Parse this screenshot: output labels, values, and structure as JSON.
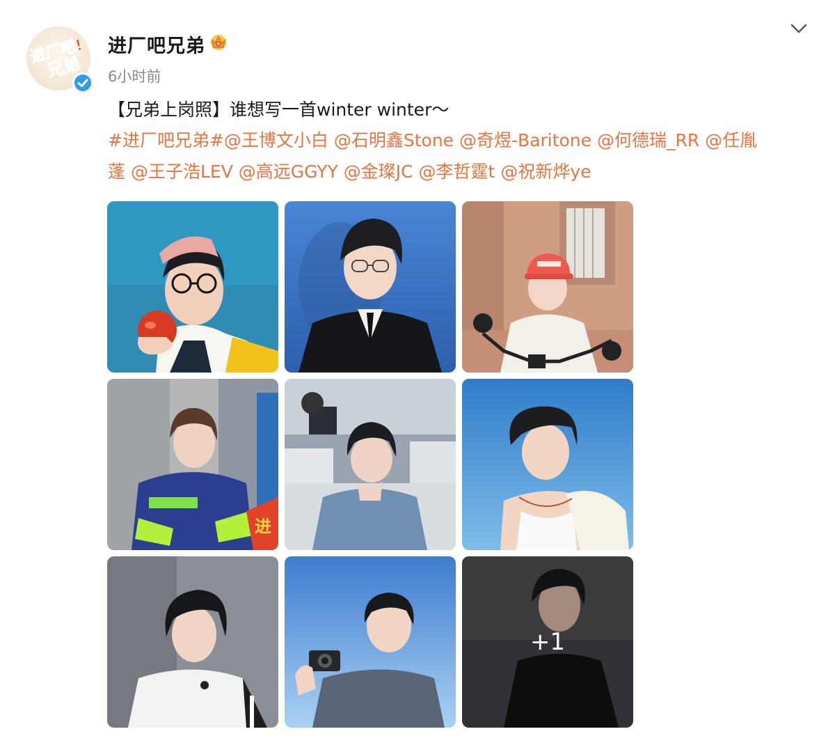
{
  "post": {
    "author": "进厂吧兄弟",
    "time": "6小时前",
    "title": "【兄弟上岗照】谁想写一首winter winter～",
    "hashtag": "#进厂吧兄弟#",
    "mentions_line1": [
      "@王博文小白",
      "@石明鑫Stone",
      "@奇煜-Baritone",
      "@何德瑞_RR",
      "@任胤"
    ],
    "mentions_line2": [
      "蓬",
      "@王子浩LEV",
      "@高远GGYY",
      "@金璨JC",
      "@李哲霆t",
      "@祝新烨ye"
    ],
    "more_count": "+1"
  },
  "avatar": {
    "logo_text_top": "进厂吧!",
    "logo_text_bottom": "兄弟"
  },
  "colors": {
    "accent": "#eb7340",
    "verified": "#2d9cf0",
    "text": "#1a1a1a",
    "muted": "#8a8a8a"
  },
  "icons": {
    "crown": "crown-badge-icon",
    "verified": "verified-check-icon",
    "menu": "chevron-down-icon"
  },
  "photos": [
    {
      "name": "photo-1",
      "bg": "#2e8fb8"
    },
    {
      "name": "photo-2",
      "bg": "#3b78c8"
    },
    {
      "name": "photo-3",
      "bg": "#c9967e"
    },
    {
      "name": "photo-4",
      "bg": "#a9aeb3"
    },
    {
      "name": "photo-5",
      "bg": "#8e98a6"
    },
    {
      "name": "photo-6",
      "bg": "#5fa7dd"
    },
    {
      "name": "photo-7",
      "bg": "#8c9096"
    },
    {
      "name": "photo-8",
      "bg": "#4f8fd6"
    },
    {
      "name": "photo-9",
      "bg": "#3a3c3f"
    }
  ]
}
